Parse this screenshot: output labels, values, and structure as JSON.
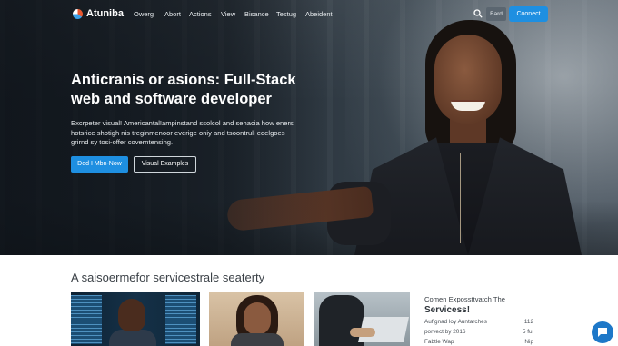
{
  "brand": {
    "name": "Atuniba",
    "colors": {
      "accent": "#1e8fe1",
      "logo_orange": "#e8582f",
      "logo_blue": "#3aa0e8"
    }
  },
  "nav": {
    "links": [
      "Owerg",
      "Abort",
      "Actions",
      "View",
      "Bisance",
      "Testug",
      "Abeident"
    ],
    "search_icon": "search-icon",
    "card_label": "Bard",
    "connect_label": "Coonect"
  },
  "hero": {
    "title_line1": "Anticranis or asions: Full-Stack",
    "title_line2": "web and software developer",
    "desc_line1": "Excrpeter visual! Americantal!ampinstand ssolcol and senacia how eners",
    "desc_line2": "hotsrice shotigh nis treginmenoor everige oniy  and tsoontruli edelgoes",
    "desc_line3": "grirnd sy tosi-offer coverntensing.",
    "primary_button": "Ded I Mbn-Now",
    "secondary_button": "Visual Examples"
  },
  "services": {
    "title": "A saisoermefor servicestrale seaterty",
    "side_title": "Comen Expossttvatch The",
    "side_subtitle": "Servicess!",
    "rows": [
      {
        "label": "Aufignad loy Auntarches",
        "value": "112"
      },
      {
        "label": "porvect by 2016",
        "value": "5 ful"
      },
      {
        "label": "Fabtle Wap",
        "value": "Nip"
      }
    ]
  },
  "chat_icon": "chat-bubble-icon"
}
